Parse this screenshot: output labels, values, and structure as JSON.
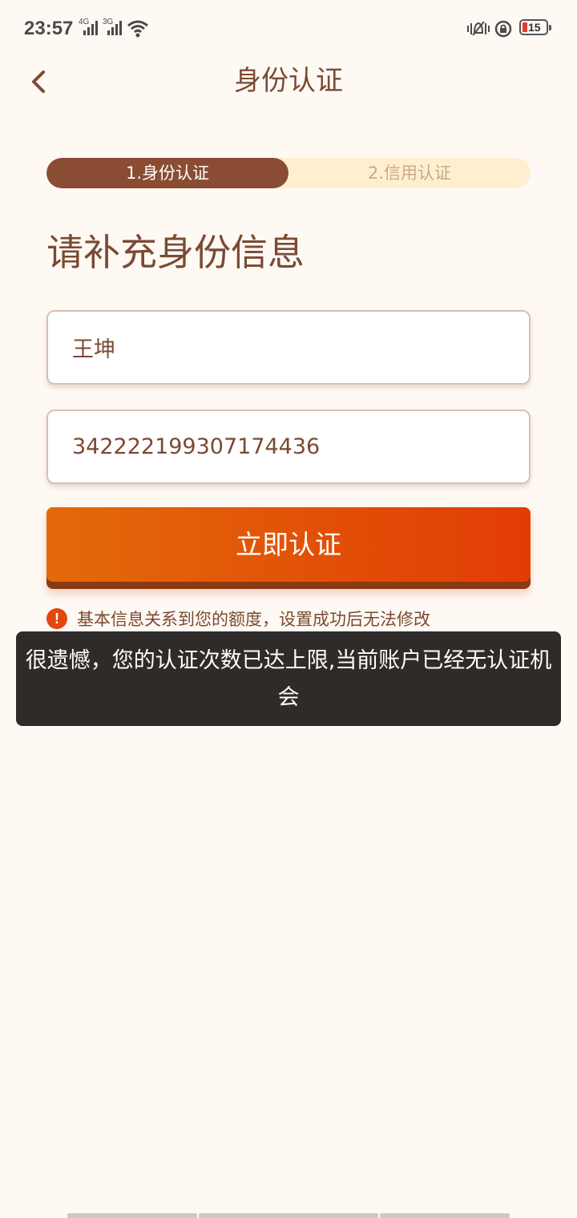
{
  "status_bar": {
    "time": "23:57",
    "network_1": "4G",
    "network_2": "3G",
    "battery_level": "15",
    "battery_color": "#E53935"
  },
  "header": {
    "title": "身份认证",
    "back_icon": "chevron-left-icon"
  },
  "steps": {
    "active_label": "1.身份认证",
    "inactive_label": "2.信用认证"
  },
  "form": {
    "heading": "请补充身份信息",
    "name_value": "王坤",
    "id_value": "342222199307174436",
    "submit_label": "立即认证"
  },
  "notice": {
    "icon": "exclamation-circle-icon",
    "icon_glyph": "!",
    "text": "基本信息关系到您的额度，设置成功后无法修改"
  },
  "toast": {
    "message": "很遗憾，您的认证次数已达上限,当前账户已经无认证机会"
  },
  "colors": {
    "background": "#FFF9F4",
    "brand_brown": "#8A4D33",
    "text_brown": "#7A4A32",
    "accent_orange": "#E36A0A",
    "accent_red_orange": "#E23C05",
    "step_bg": "#FFEFCF",
    "toast_bg": "#2F2B28"
  }
}
